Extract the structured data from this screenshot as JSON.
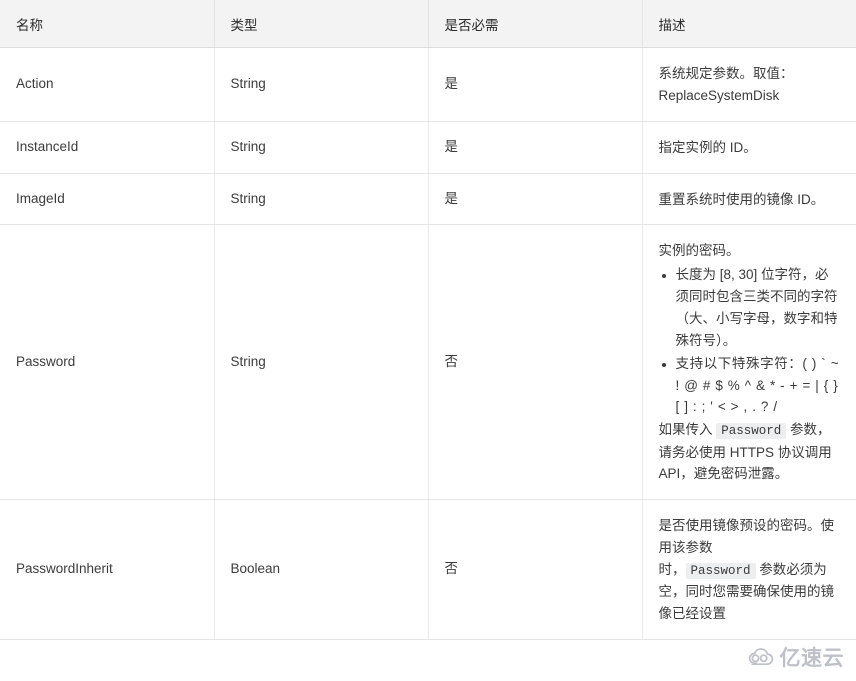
{
  "table": {
    "columns": [
      {
        "key": "name",
        "label": "名称"
      },
      {
        "key": "type",
        "label": "类型"
      },
      {
        "key": "required",
        "label": "是否必需"
      },
      {
        "key": "description",
        "label": "描述"
      }
    ],
    "rows": [
      {
        "name": "Action",
        "type": "String",
        "required": "是",
        "description": {
          "paragraphs": [
            "系统规定参数。取值：ReplaceSystemDisk"
          ]
        }
      },
      {
        "name": "InstanceId",
        "type": "String",
        "required": "是",
        "description": {
          "paragraphs": [
            "指定实例的 ID。"
          ]
        }
      },
      {
        "name": "ImageId",
        "type": "String",
        "required": "是",
        "description": {
          "paragraphs": [
            "重置系统时使用的镜像 ID。"
          ]
        }
      },
      {
        "name": "Password",
        "type": "String",
        "required": "否",
        "description": {
          "intro": "实例的密码。",
          "bullets": [
            "长度为 [8, 30] 位字符，必须同时包含三类不同的字符（大、小写字母，数字和特殊符号）。",
            "支持以下特殊字符：( ) ` ~ ! @ # $ % ^ & * - + = | { } [ ] : ; ' < > , . ? /"
          ],
          "note_before_code": "如果传入 ",
          "note_code": "Password",
          "note_after_code": " 参数，请务必使用 HTTPS 协议调用 API，避免密码泄露。"
        }
      },
      {
        "name": "PasswordInherit",
        "type": "Boolean",
        "required": "否",
        "description": {
          "intro": "是否使用镜像预设的密码。使用该参数",
          "note_before_code": "时，",
          "note_code": "Password",
          "note_after_code": " 参数必须为空，同时您需要确保使用的镜像已经设置"
        }
      }
    ]
  },
  "watermark": {
    "text": "亿速云",
    "icon": "cloud-logo-icon",
    "color": "#b9bcc4"
  }
}
